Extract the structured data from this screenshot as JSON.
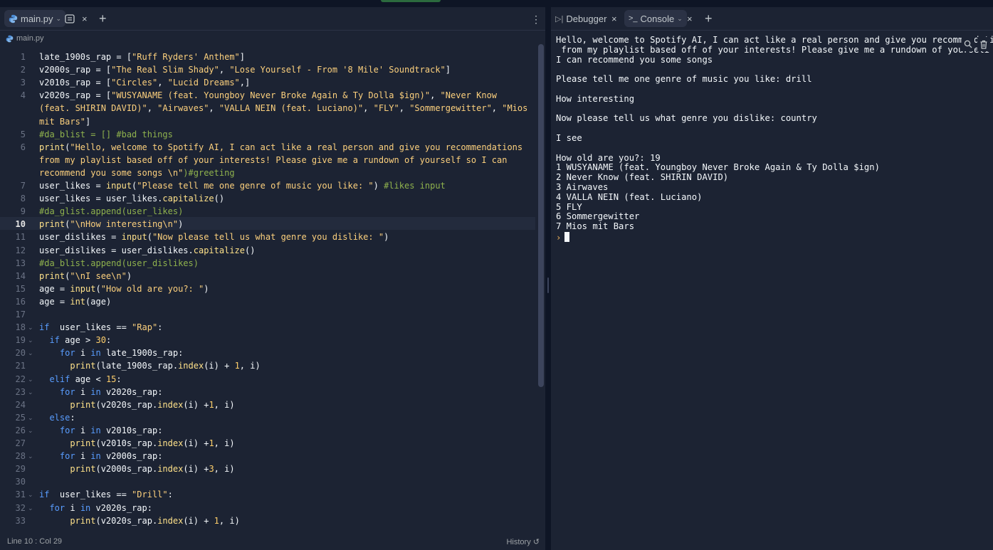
{
  "editor": {
    "tab": {
      "label": "main.py",
      "icon": "python-icon"
    },
    "breadcrumb": "main.py",
    "current_line": 10,
    "lines": [
      {
        "n": "1",
        "html": "late_1900s_rap = [<span class=\"st\">\"Ruff Ryders' Anthem\"</span>]"
      },
      {
        "n": "2",
        "html": "v2000s_rap = [<span class=\"st\">\"The Real Slim Shady\"</span>, <span class=\"st\">\"Lose Yourself - From '8 Mile' Soundtrack\"</span>]"
      },
      {
        "n": "3",
        "html": "v2010s_rap = [<span class=\"st\">\"Circles\"</span>, <span class=\"st\">\"Lucid Dreams\"</span>,]"
      },
      {
        "n": "4",
        "html": "v2020s_rap = [<span class=\"st\">\"WUSYANAME (feat. Youngboy Never Broke Again &amp; Ty Dolla $ign)\"</span>, <span class=\"st\">\"Never Know</span>"
      },
      {
        "n": "",
        "html": "<span class=\"st\">(feat. SHIRIN DAVID)\"</span>, <span class=\"st\">\"Airwaves\"</span>, <span class=\"st\">\"VALLA NEIN (feat. Luciano)\"</span>, <span class=\"st\">\"FLY\"</span>, <span class=\"st\">\"Sommergewitter\"</span>, <span class=\"st\">\"Mios</span>"
      },
      {
        "n": "",
        "html": "<span class=\"st\">mit Bars\"</span>]"
      },
      {
        "n": "5",
        "html": "<span class=\"cm\">#da_blist = [] #bad things</span>"
      },
      {
        "n": "6",
        "html": "<span class=\"fn\">print</span>(<span class=\"st\">\"Hello, welcome to Spotify AI, I can act like a real person and give you recommendations</span>"
      },
      {
        "n": "",
        "html": "<span class=\"st\">from my playlist based off of your interests! Please give me a rundown of yourself so I can</span>"
      },
      {
        "n": "",
        "html": "<span class=\"st\">recommend you some songs \\n\"</span><span class=\"cm\">)#greeting</span>"
      },
      {
        "n": "7",
        "html": "user_likes = <span class=\"fn\">input</span>(<span class=\"st\">\"Please tell me one genre of music you like: \"</span>) <span class=\"cm\">#likes input</span>"
      },
      {
        "n": "8",
        "html": "user_likes = user_likes.<span class=\"fn\">capitalize</span>()"
      },
      {
        "n": "9",
        "html": "<span class=\"cm\">#da_glist.append(user_likes)</span>"
      },
      {
        "n": "10",
        "html": "<span class=\"fn\">print</span>(<span class=\"st\">\"\\nHow interesting\\n\"</span>)"
      },
      {
        "n": "11",
        "html": "user_dislikes = <span class=\"fn\">input</span>(<span class=\"st\">\"Now please tell us what genre you dislike: \"</span>)"
      },
      {
        "n": "12",
        "html": "user_dislikes = user_dislikes.<span class=\"fn\">capitalize</span>()"
      },
      {
        "n": "13",
        "html": "<span class=\"cm\">#da_blist.append(user_dislikes)</span>"
      },
      {
        "n": "14",
        "html": "<span class=\"fn\">print</span>(<span class=\"st\">\"\\nI see\\n\"</span>)"
      },
      {
        "n": "15",
        "html": "age = <span class=\"fn\">input</span>(<span class=\"st\">\"How old are you?: \"</span>)"
      },
      {
        "n": "16",
        "html": "age = <span class=\"fn\">int</span>(age)"
      },
      {
        "n": "17",
        "html": ""
      },
      {
        "n": "18",
        "fold": true,
        "html": "<span class=\"kw\">if</span>  user_likes == <span class=\"st\">\"Rap\"</span>:"
      },
      {
        "n": "19",
        "fold": true,
        "html": "  <span class=\"kw\">if</span> age &gt; <span class=\"nm\">30</span>:"
      },
      {
        "n": "20",
        "fold": true,
        "html": "    <span class=\"kw\">for</span> i <span class=\"kw\">in</span> late_1900s_rap:"
      },
      {
        "n": "21",
        "html": "      <span class=\"fn\">print</span>(late_1900s_rap.<span class=\"fn\">index</span>(i) + <span class=\"nm\">1</span>, i)"
      },
      {
        "n": "22",
        "fold": true,
        "html": "  <span class=\"kw\">elif</span> age &lt; <span class=\"nm\">15</span>:"
      },
      {
        "n": "23",
        "fold": true,
        "html": "    <span class=\"kw\">for</span> i <span class=\"kw\">in</span> v2020s_rap:"
      },
      {
        "n": "24",
        "html": "      <span class=\"fn\">print</span>(v2020s_rap.<span class=\"fn\">index</span>(i) +<span class=\"nm\">1</span>, i)"
      },
      {
        "n": "25",
        "fold": true,
        "html": "  <span class=\"kw\">else</span>:"
      },
      {
        "n": "26",
        "fold": true,
        "html": "    <span class=\"kw\">for</span> i <span class=\"kw\">in</span> v2010s_rap:"
      },
      {
        "n": "27",
        "html": "      <span class=\"fn\">print</span>(v2010s_rap.<span class=\"fn\">index</span>(i) +<span class=\"nm\">1</span>, i)"
      },
      {
        "n": "28",
        "fold": true,
        "html": "    <span class=\"kw\">for</span> i <span class=\"kw\">in</span> v2000s_rap:"
      },
      {
        "n": "29",
        "html": "      <span class=\"fn\">print</span>(v2000s_rap.<span class=\"fn\">index</span>(i) +<span class=\"nm\">3</span>, i)"
      },
      {
        "n": "30",
        "html": ""
      },
      {
        "n": "31",
        "fold": true,
        "html": "<span class=\"kw\">if</span>  user_likes == <span class=\"st\">\"Drill\"</span>:"
      },
      {
        "n": "32",
        "fold": true,
        "html": "  <span class=\"kw\">for</span> i <span class=\"kw\">in</span> v2020s_rap:"
      },
      {
        "n": "33",
        "html": "      <span class=\"fn\">print</span>(v2020s_rap.<span class=\"fn\">index</span>(i) + <span class=\"nm\">1</span>, i)"
      }
    ],
    "status": {
      "position": "Line 10 : Col 29",
      "history": "History"
    }
  },
  "right_panel": {
    "tabs": [
      {
        "label": "Debugger",
        "icon": "debugger-icon"
      },
      {
        "label": "Console",
        "icon": "terminal-icon"
      }
    ],
    "console_lines": [
      "Hello, welcome to Spotify AI, I can act like a real person and give you recommendati",
      " from my playlist based off of your interests! Please give me a rundown of yourseli so",
      "I can recommend you some songs",
      "",
      "Please tell me one genre of music you like: drill",
      "",
      "How interesting",
      "",
      "Now please tell us what genre you dislike: country",
      "",
      "I see",
      "",
      "How old are you?: 19",
      "1 WUSYANAME (feat. Youngboy Never Broke Again & Ty Dolla $ign)",
      "2 Never Know (feat. SHIRIN DAVID)",
      "3 Airwaves",
      "4 VALLA NEIN (feat. Luciano)",
      "5 FLY",
      "6 Sommergewitter",
      "7 Mios mit Bars"
    ],
    "prompt_symbol": "›"
  },
  "colors": {
    "background": "#0e1525",
    "panel": "#1c2333",
    "keyword": "#599dff",
    "string": "#fcd07d",
    "comment": "#8fb24d",
    "prompt": "#f2b35a"
  }
}
